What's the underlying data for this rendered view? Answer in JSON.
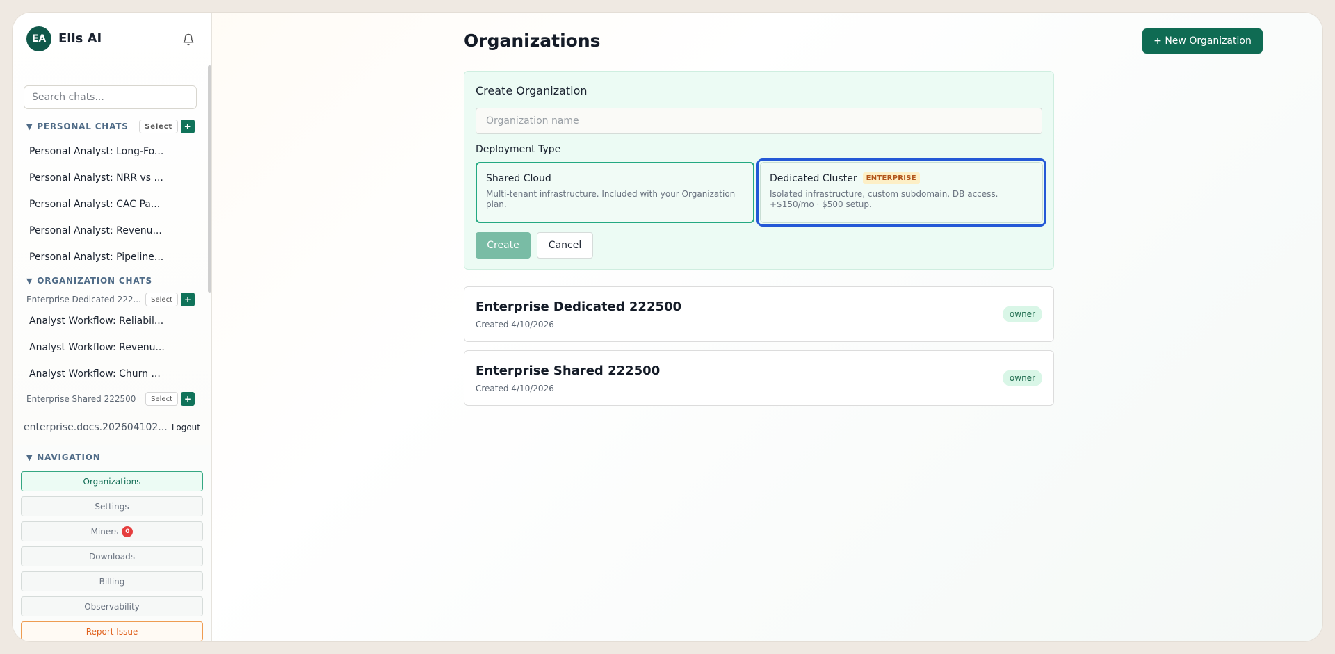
{
  "app": {
    "initials": "EA",
    "title": "Elis AI"
  },
  "sidebar": {
    "search_placeholder": "Search chats...",
    "personal": {
      "header": "PERSONAL CHATS",
      "select_label": "Select",
      "add_label": "+",
      "items": [
        "Personal Analyst: Long-Fo...",
        "Personal Analyst: NRR vs ...",
        "Personal Analyst: CAC Pa...",
        "Personal Analyst: Revenu...",
        "Personal Analyst: Pipeline..."
      ]
    },
    "organization": {
      "header": "ORGANIZATION CHATS",
      "groups": [
        {
          "name": "Enterprise Dedicated 222...",
          "select_label": "Select",
          "add_label": "+",
          "items": [
            "Analyst Workflow: Reliabil...",
            "Analyst Workflow: Revenu...",
            "Analyst Workflow: Churn ..."
          ]
        },
        {
          "name": "Enterprise Shared 222500",
          "select_label": "Select",
          "add_label": "+"
        }
      ]
    },
    "user_email": "enterprise.docs.202604102...",
    "logout_label": "Logout",
    "navigation": {
      "header": "NAVIGATION",
      "items": [
        {
          "label": "Organizations"
        },
        {
          "label": "Settings"
        },
        {
          "label": "Miners",
          "badge": "0"
        },
        {
          "label": "Downloads"
        },
        {
          "label": "Billing"
        },
        {
          "label": "Observability"
        },
        {
          "label": "Report Issue"
        }
      ]
    }
  },
  "main": {
    "title": "Organizations",
    "new_button": "+ New Organization",
    "create_form": {
      "title": "Create Organization",
      "name_placeholder": "Organization name",
      "deployment_label": "Deployment Type",
      "options": [
        {
          "name": "Shared Cloud",
          "description": "Multi-tenant infrastructure. Included with your Organization plan."
        },
        {
          "name": "Dedicated Cluster",
          "badge": "ENTERPRISE",
          "description": "Isolated infrastructure, custom subdomain, DB access. +$150/mo · $500 setup."
        }
      ],
      "create_label": "Create",
      "cancel_label": "Cancel"
    },
    "organizations": [
      {
        "name": "Enterprise Dedicated 222500",
        "created": "Created 4/10/2026",
        "role": "owner"
      },
      {
        "name": "Enterprise Shared 222500",
        "created": "Created 4/10/2026",
        "role": "owner"
      }
    ]
  },
  "colors": {
    "brand": "#0f6b53",
    "focus": "#2458d6",
    "report": "#e0611c",
    "badge_red": "#e53e3e"
  }
}
